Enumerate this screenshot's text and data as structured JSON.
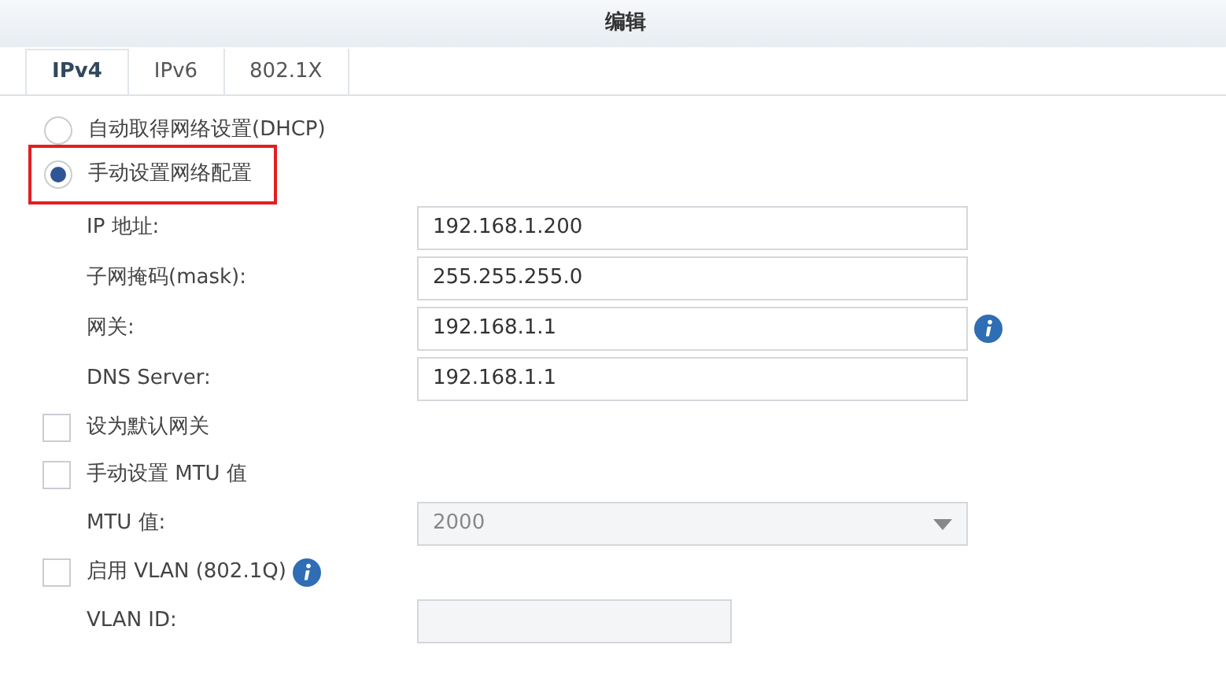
{
  "window": {
    "title": "编辑"
  },
  "tabs": [
    {
      "label": "IPv4",
      "selected": true
    },
    {
      "label": "IPv6",
      "selected": false
    },
    {
      "label": "802.1X",
      "selected": false
    }
  ],
  "modes": [
    {
      "label": "自动取得网络设置(DHCP)",
      "selected": false,
      "highlighted": false
    },
    {
      "label": "手动设置网络配置",
      "selected": true,
      "highlighted": true
    }
  ],
  "rows": [
    {
      "kind": "field",
      "label": "IP 地址:",
      "value": "192.168.1.200",
      "info": false,
      "disabled": false
    },
    {
      "kind": "field",
      "label": "子网掩码(mask):",
      "value": "255.255.255.0",
      "info": false,
      "disabled": false
    },
    {
      "kind": "field",
      "label": "网关:",
      "value": "192.168.1.1",
      "info": true,
      "disabled": false
    },
    {
      "kind": "field",
      "label": "DNS Server:",
      "value": "192.168.1.1",
      "info": false,
      "disabled": false
    },
    {
      "kind": "checkbox",
      "label": "设为默认网关",
      "checked": false,
      "info": false
    },
    {
      "kind": "checkbox",
      "label": "手动设置 MTU 值",
      "checked": false,
      "info": false
    },
    {
      "kind": "select",
      "label": "MTU 值:",
      "value": "2000",
      "disabled": true
    },
    {
      "kind": "checkbox",
      "label": "启用 VLAN (802.1Q)",
      "checked": false,
      "info": true
    },
    {
      "kind": "field",
      "label": "VLAN ID:",
      "info": false,
      "disabled": true,
      "short": true
    }
  ]
}
